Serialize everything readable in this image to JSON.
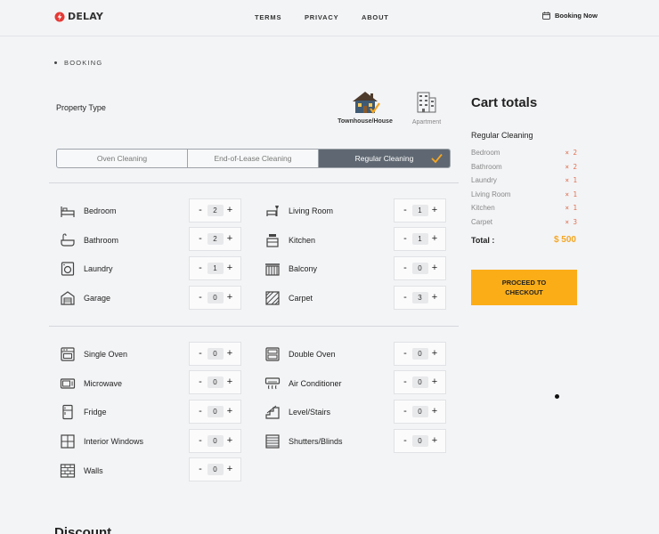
{
  "header": {
    "logo": "DELAY",
    "nav": [
      "TERMS",
      "PRIVACY",
      "ABOUT"
    ],
    "booking_now": "Booking Now"
  },
  "breadcrumb": "BOOKING",
  "property_type": {
    "label": "Property Type",
    "options": [
      {
        "label": "Townhouse/House",
        "selected": true
      },
      {
        "label": "Apartment",
        "selected": false
      }
    ]
  },
  "tabs": [
    {
      "label": "Oven Cleaning",
      "active": false
    },
    {
      "label": "End-of-Lease Cleaning",
      "active": false
    },
    {
      "label": "Regular Cleaning",
      "active": true
    }
  ],
  "rooms": [
    {
      "label": "Bedroom",
      "icon": "bed-icon",
      "value": "2"
    },
    {
      "label": "Living Room",
      "icon": "living-room-icon",
      "value": "1"
    },
    {
      "label": "Bathroom",
      "icon": "bathtub-icon",
      "value": "2"
    },
    {
      "label": "Kitchen",
      "icon": "kitchen-icon",
      "value": "1"
    },
    {
      "label": "Laundry",
      "icon": "washing-machine-icon",
      "value": "1"
    },
    {
      "label": "Balcony",
      "icon": "balcony-icon",
      "value": "0"
    },
    {
      "label": "Garage",
      "icon": "garage-icon",
      "value": "0"
    },
    {
      "label": "Carpet",
      "icon": "carpet-icon",
      "value": "3"
    }
  ],
  "extras": [
    {
      "label": "Single Oven",
      "icon": "oven-icon",
      "value": "0"
    },
    {
      "label": "Double Oven",
      "icon": "double-oven-icon",
      "value": "0"
    },
    {
      "label": "Microwave",
      "icon": "microwave-icon",
      "value": "0"
    },
    {
      "label": "Air Conditioner",
      "icon": "air-conditioner-icon",
      "value": "0"
    },
    {
      "label": "Fridge",
      "icon": "fridge-icon",
      "value": "0"
    },
    {
      "label": "Level/Stairs",
      "icon": "stairs-icon",
      "value": "0"
    },
    {
      "label": "Interior Windows",
      "icon": "window-icon",
      "value": "0"
    },
    {
      "label": "Shutters/Blinds",
      "icon": "blinds-icon",
      "value": "0"
    },
    {
      "label": "Walls",
      "icon": "brick-wall-icon",
      "value": "0"
    }
  ],
  "stepper": {
    "minus": "-",
    "plus": "+"
  },
  "cart": {
    "title": "Cart totals",
    "service": "Regular Cleaning",
    "items": [
      {
        "label": "Bedroom",
        "qty": "× 2"
      },
      {
        "label": "Bathroom",
        "qty": "× 2"
      },
      {
        "label": "Laundry",
        "qty": "× 1"
      },
      {
        "label": "Living Room",
        "qty": "× 1"
      },
      {
        "label": "Kitchen",
        "qty": "× 1"
      },
      {
        "label": "Carpet",
        "qty": "× 3"
      }
    ],
    "total_label": "Total :",
    "total_value": "$ 500",
    "checkout_line1": "PROCEED TO",
    "checkout_line2": "CHECKOUT"
  },
  "discount_heading": "Discount",
  "colors": {
    "accent": "#fbad18",
    "active_tab": "#5f6872",
    "total": "#f5a623",
    "qty": "#e07050",
    "logo_red": "#e53935"
  }
}
